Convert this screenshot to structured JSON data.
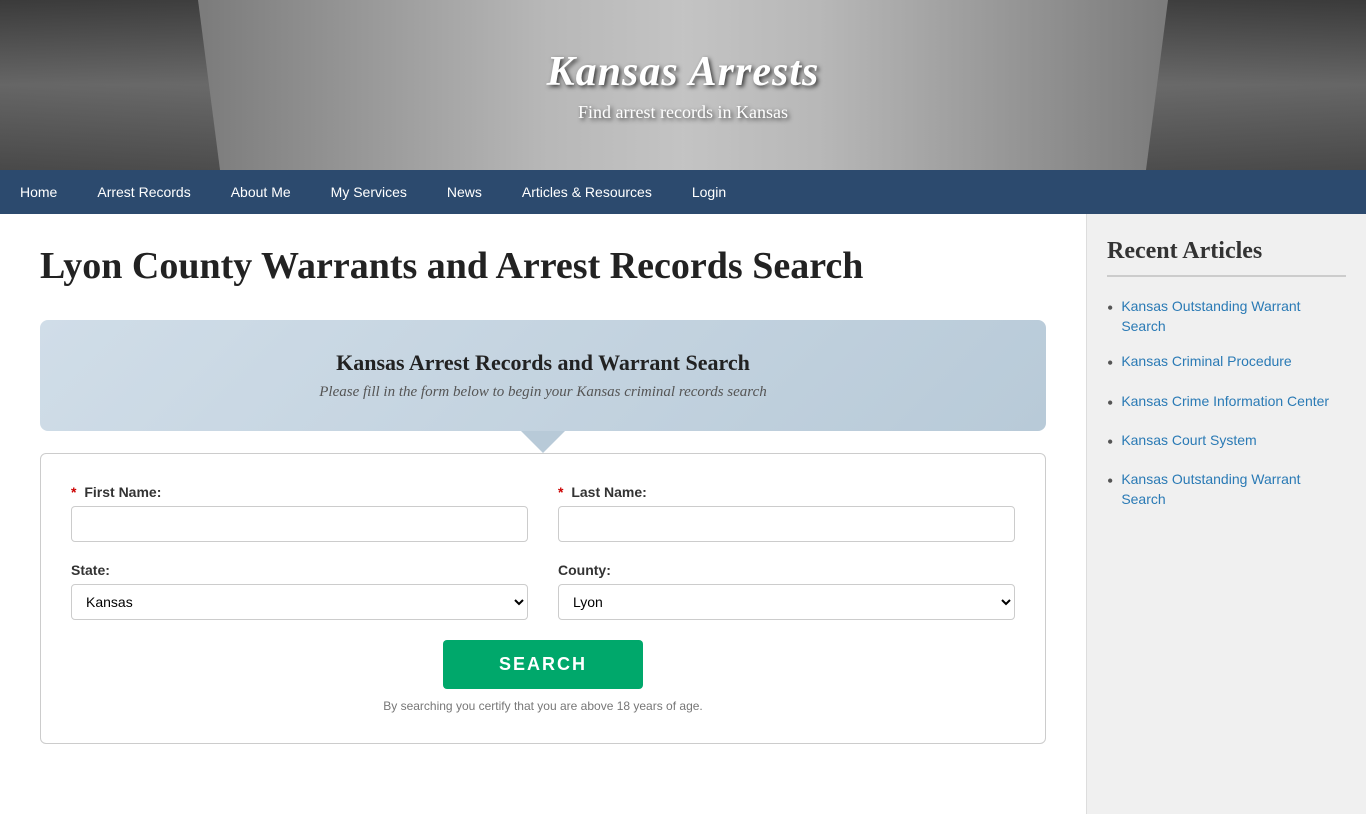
{
  "hero": {
    "title": "Kansas Arrests",
    "subtitle": "Find arrest records in Kansas"
  },
  "nav": {
    "items": [
      {
        "label": "Home",
        "active": false
      },
      {
        "label": "Arrest Records",
        "active": false
      },
      {
        "label": "About Me",
        "active": false
      },
      {
        "label": "My Services",
        "active": false
      },
      {
        "label": "News",
        "active": false
      },
      {
        "label": "Articles & Resources",
        "active": false
      },
      {
        "label": "Login",
        "active": false
      }
    ]
  },
  "main": {
    "page_title": "Lyon County Warrants and Arrest Records Search",
    "search_card": {
      "title": "Kansas Arrest Records and Warrant Search",
      "subtitle": "Please fill in the form below to begin your Kansas criminal records search"
    },
    "form": {
      "first_name_label": "First Name:",
      "last_name_label": "Last Name:",
      "state_label": "State:",
      "county_label": "County:",
      "state_value": "Kansas",
      "county_value": "Lyon",
      "search_button": "SEARCH",
      "note": "By searching you certify that you are above 18 years of age.",
      "required_indicator": "*"
    }
  },
  "sidebar": {
    "title": "Recent Articles",
    "articles": [
      {
        "label": "Kansas Outstanding Warrant Search"
      },
      {
        "label": "Kansas Criminal Procedure"
      },
      {
        "label": "Kansas Crime Information Center"
      },
      {
        "label": "Kansas Court System"
      },
      {
        "label": "Kansas Outstanding Warrant Search"
      }
    ]
  }
}
